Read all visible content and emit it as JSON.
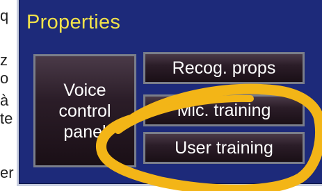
{
  "background_text": [
    "q",
    "z",
    "o",
    "à",
    "te",
    "er"
  ],
  "panel": {
    "title": "Properties",
    "buttons": {
      "voice_control_panel": [
        "Voice",
        "control",
        "panel"
      ],
      "recog_props": "Recog. props",
      "mic_training": "Mic. training",
      "user_training": "User training"
    }
  },
  "colors": {
    "panel_bg": "#1d2a7a",
    "title": "#f2e24a",
    "button_text": "#ffffff",
    "highlight_scribble": "#f3b517"
  }
}
